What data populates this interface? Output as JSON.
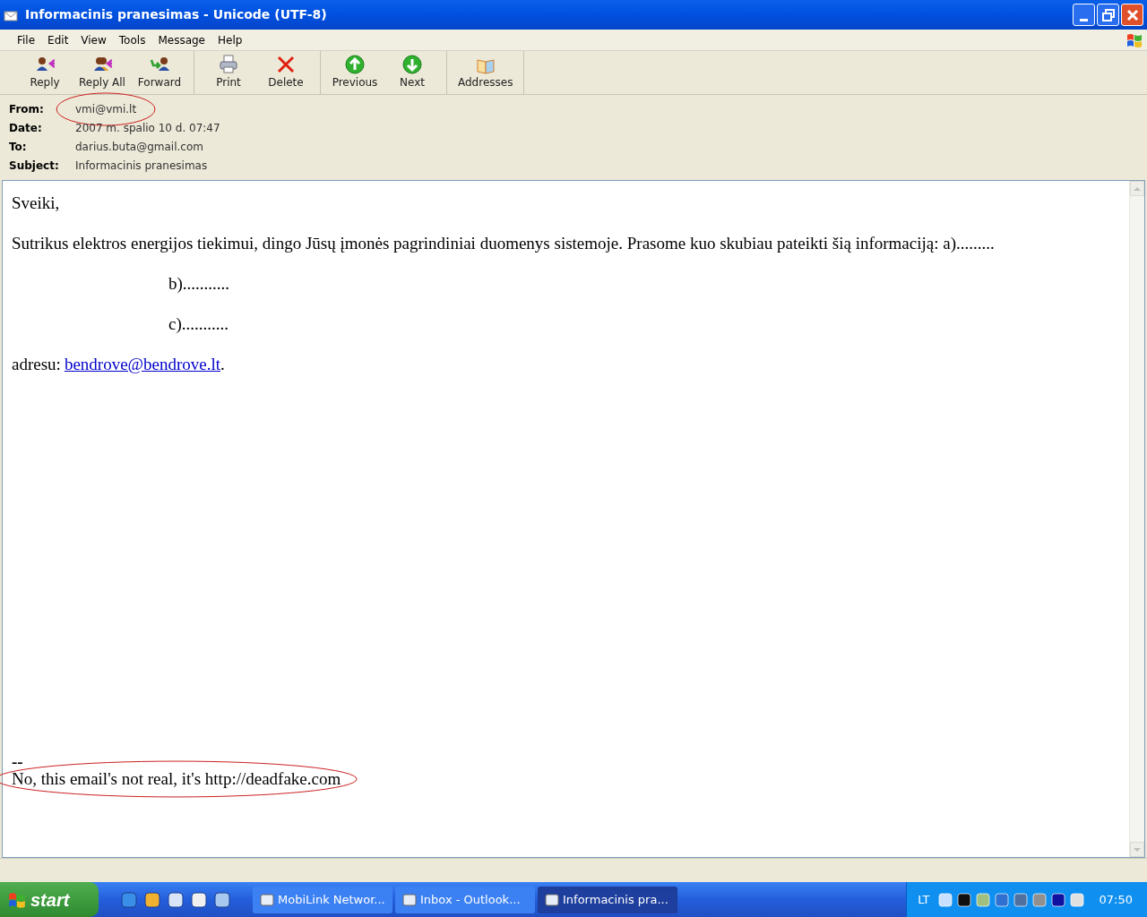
{
  "window": {
    "title": "Informacinis pranesimas - Unicode (UTF-8)"
  },
  "menu": [
    "File",
    "Edit",
    "View",
    "Tools",
    "Message",
    "Help"
  ],
  "toolbar": [
    [
      {
        "label": "Reply"
      },
      {
        "label": "Reply All"
      },
      {
        "label": "Forward"
      }
    ],
    [
      {
        "label": "Print"
      },
      {
        "label": "Delete"
      }
    ],
    [
      {
        "label": "Previous"
      },
      {
        "label": "Next"
      }
    ],
    [
      {
        "label": "Addresses"
      }
    ]
  ],
  "header": [
    {
      "label": "From:",
      "value": "vmi@vmi.lt",
      "circled": true
    },
    {
      "label": "Date:",
      "value": "2007 m. spalio 10 d. 07:47",
      "circled": false
    },
    {
      "label": "To:",
      "value": "darius.buta@gmail.com",
      "circled": false
    },
    {
      "label": "Subject:",
      "value": "Informacinis pranesimas",
      "circled": false
    }
  ],
  "body": {
    "greeting": "Sveiki,",
    "paragraph": "Sutrikus elektros energijos tiekimui, dingo Jūsų įmonės pagrindiniai duomenys sistemoje. Prasome kuo skubiau pateikti šią informaciją: a).........",
    "items": [
      "b)...........",
      "c)..........."
    ],
    "address_prefix": "adresu:",
    "address_link": "bendrove@bendrove.lt",
    "address_suffix": ".",
    "signature_dash": "--",
    "signature": "No, this email's not real, it's http://deadfake.com",
    "signature_circled": true
  },
  "taskbar": {
    "start": "start",
    "tasks": [
      {
        "label": "MobiLink Networ...",
        "selected": false
      },
      {
        "label": "Inbox - Outlook...",
        "selected": false
      },
      {
        "label": "Informacinis pra...",
        "selected": true
      }
    ],
    "language": "LT",
    "clock": "07:50"
  }
}
